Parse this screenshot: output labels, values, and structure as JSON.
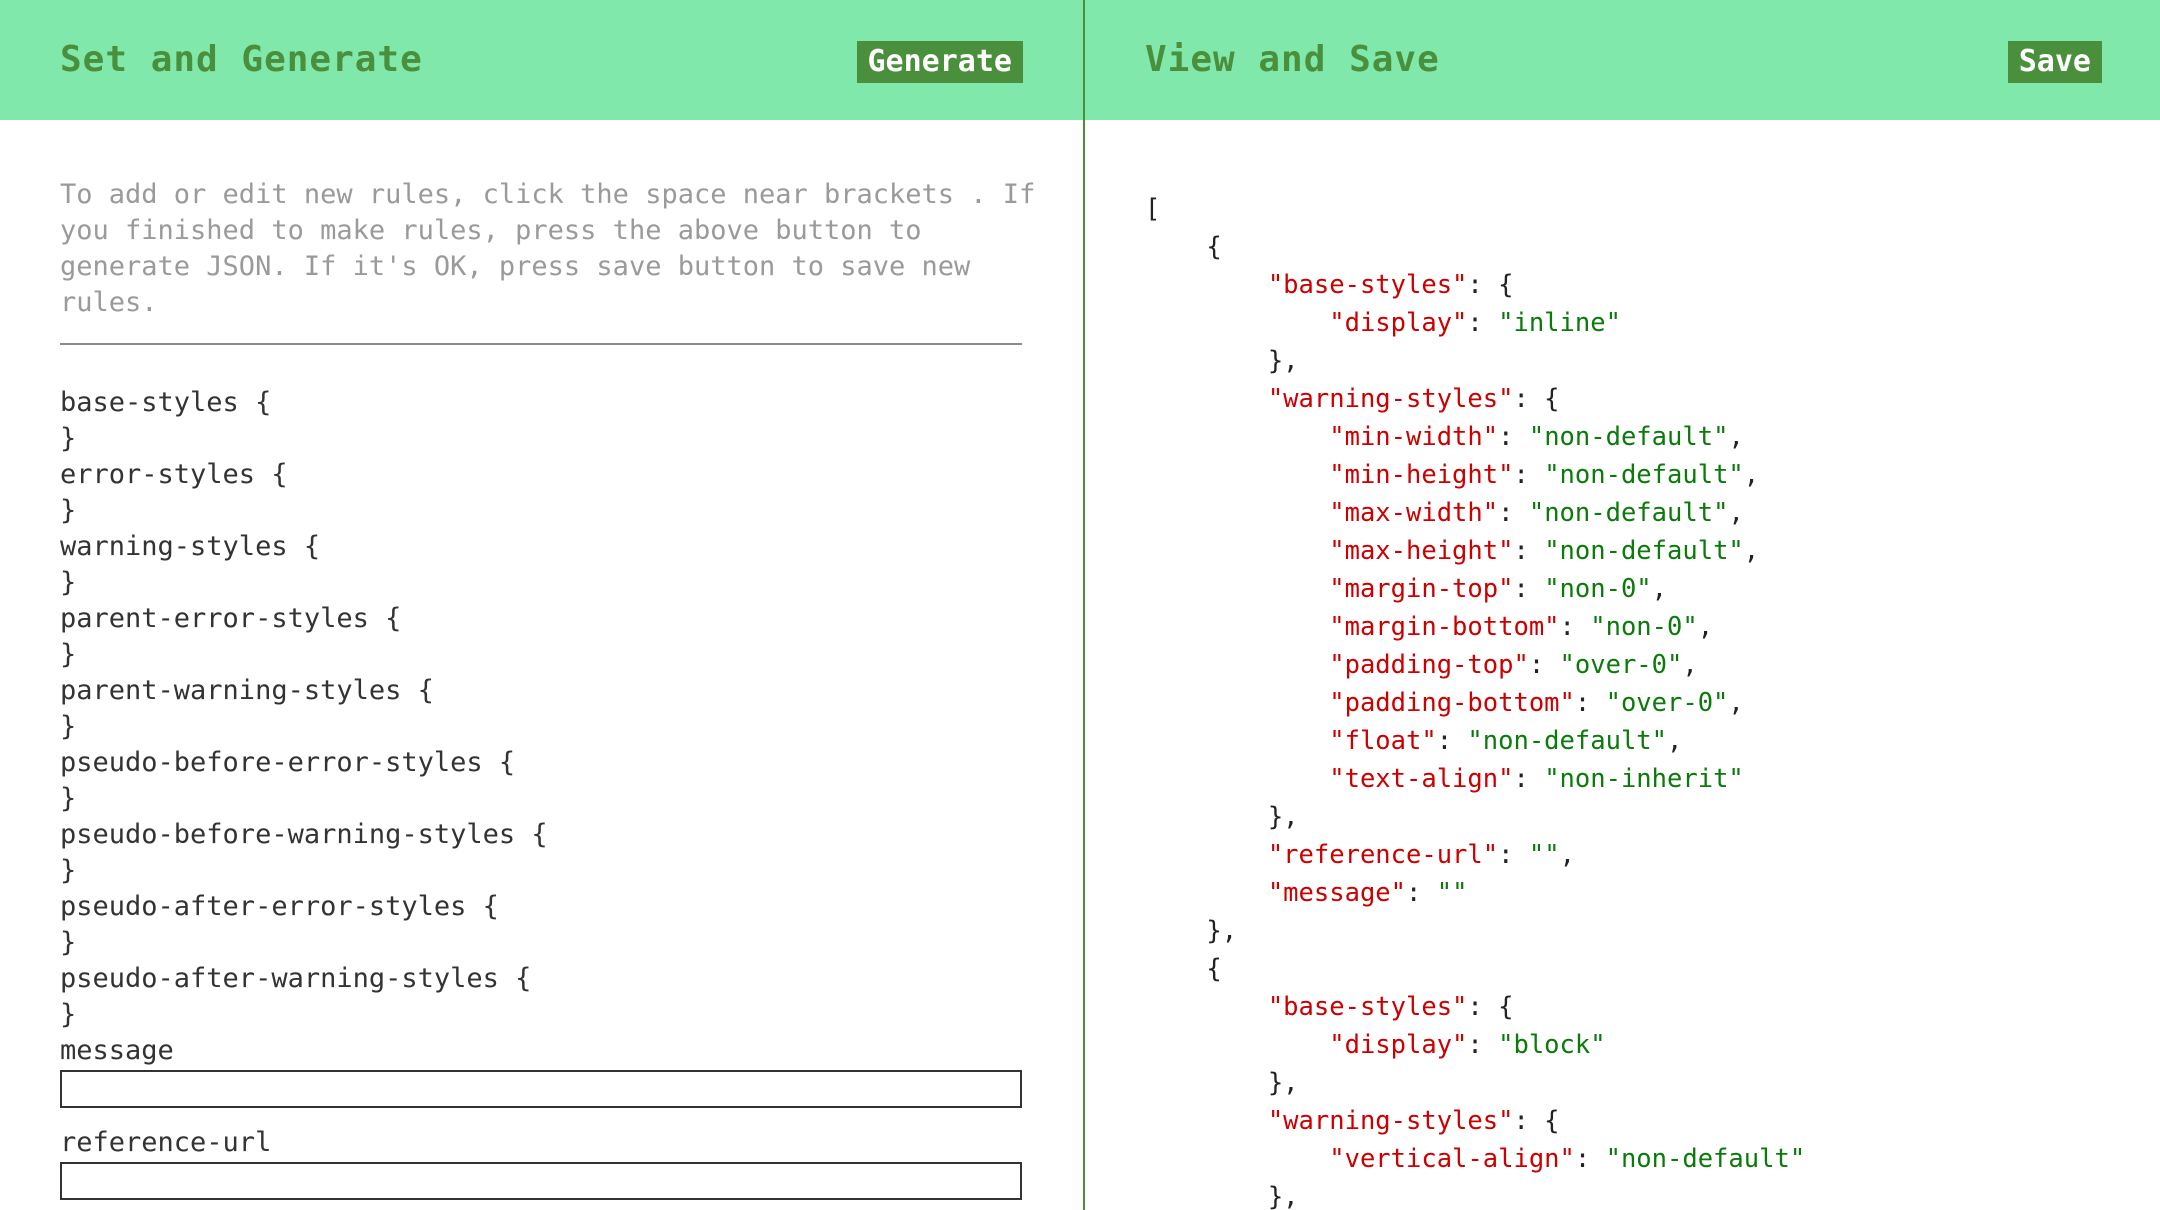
{
  "left": {
    "title": "Set and Generate",
    "generate_label": "Generate",
    "instructions": "To add or edit new rules, click the space near brackets . If you finished to make rules, press the above button to generate JSON. If it's OK, press save button to save new rules.",
    "rules": [
      "base-styles {",
      "}",
      "error-styles {",
      "}",
      "warning-styles {",
      "}",
      "parent-error-styles {",
      "}",
      "parent-warning-styles {",
      "}",
      "pseudo-before-error-styles {",
      "}",
      "pseudo-before-warning-styles {",
      "}",
      "pseudo-after-error-styles {",
      "}",
      "pseudo-after-warning-styles {",
      "}"
    ],
    "message_label": "message",
    "message_value": "",
    "reference_url_label": "reference-url",
    "reference_url_value": ""
  },
  "right": {
    "title": "View and Save",
    "save_label": "Save",
    "json_lines": [
      {
        "indent": 0,
        "parts": [
          [
            "p",
            "["
          ]
        ]
      },
      {
        "indent": 1,
        "parts": [
          [
            "p",
            "{"
          ]
        ]
      },
      {
        "indent": 2,
        "parts": [
          [
            "k",
            "\"base-styles\""
          ],
          [
            "p",
            ": {"
          ]
        ]
      },
      {
        "indent": 3,
        "parts": [
          [
            "k",
            "\"display\""
          ],
          [
            "p",
            ": "
          ],
          [
            "s",
            "\"inline\""
          ]
        ]
      },
      {
        "indent": 2,
        "parts": [
          [
            "p",
            "},"
          ]
        ]
      },
      {
        "indent": 2,
        "parts": [
          [
            "k",
            "\"warning-styles\""
          ],
          [
            "p",
            ": {"
          ]
        ]
      },
      {
        "indent": 3,
        "parts": [
          [
            "k",
            "\"min-width\""
          ],
          [
            "p",
            ": "
          ],
          [
            "s",
            "\"non-default\""
          ],
          [
            "p",
            ","
          ]
        ]
      },
      {
        "indent": 3,
        "parts": [
          [
            "k",
            "\"min-height\""
          ],
          [
            "p",
            ": "
          ],
          [
            "s",
            "\"non-default\""
          ],
          [
            "p",
            ","
          ]
        ]
      },
      {
        "indent": 3,
        "parts": [
          [
            "k",
            "\"max-width\""
          ],
          [
            "p",
            ": "
          ],
          [
            "s",
            "\"non-default\""
          ],
          [
            "p",
            ","
          ]
        ]
      },
      {
        "indent": 3,
        "parts": [
          [
            "k",
            "\"max-height\""
          ],
          [
            "p",
            ": "
          ],
          [
            "s",
            "\"non-default\""
          ],
          [
            "p",
            ","
          ]
        ]
      },
      {
        "indent": 3,
        "parts": [
          [
            "k",
            "\"margin-top\""
          ],
          [
            "p",
            ": "
          ],
          [
            "s",
            "\"non-0\""
          ],
          [
            "p",
            ","
          ]
        ]
      },
      {
        "indent": 3,
        "parts": [
          [
            "k",
            "\"margin-bottom\""
          ],
          [
            "p",
            ": "
          ],
          [
            "s",
            "\"non-0\""
          ],
          [
            "p",
            ","
          ]
        ]
      },
      {
        "indent": 3,
        "parts": [
          [
            "k",
            "\"padding-top\""
          ],
          [
            "p",
            ": "
          ],
          [
            "s",
            "\"over-0\""
          ],
          [
            "p",
            ","
          ]
        ]
      },
      {
        "indent": 3,
        "parts": [
          [
            "k",
            "\"padding-bottom\""
          ],
          [
            "p",
            ": "
          ],
          [
            "s",
            "\"over-0\""
          ],
          [
            "p",
            ","
          ]
        ]
      },
      {
        "indent": 3,
        "parts": [
          [
            "k",
            "\"float\""
          ],
          [
            "p",
            ": "
          ],
          [
            "s",
            "\"non-default\""
          ],
          [
            "p",
            ","
          ]
        ]
      },
      {
        "indent": 3,
        "parts": [
          [
            "k",
            "\"text-align\""
          ],
          [
            "p",
            ": "
          ],
          [
            "s",
            "\"non-inherit\""
          ]
        ]
      },
      {
        "indent": 2,
        "parts": [
          [
            "p",
            "},"
          ]
        ]
      },
      {
        "indent": 2,
        "parts": [
          [
            "k",
            "\"reference-url\""
          ],
          [
            "p",
            ": "
          ],
          [
            "s",
            "\"\""
          ],
          [
            "p",
            ","
          ]
        ]
      },
      {
        "indent": 2,
        "parts": [
          [
            "k",
            "\"message\""
          ],
          [
            "p",
            ": "
          ],
          [
            "s",
            "\"\""
          ]
        ]
      },
      {
        "indent": 1,
        "parts": [
          [
            "p",
            "},"
          ]
        ]
      },
      {
        "indent": 1,
        "parts": [
          [
            "p",
            "{"
          ]
        ]
      },
      {
        "indent": 2,
        "parts": [
          [
            "k",
            "\"base-styles\""
          ],
          [
            "p",
            ": {"
          ]
        ]
      },
      {
        "indent": 3,
        "parts": [
          [
            "k",
            "\"display\""
          ],
          [
            "p",
            ": "
          ],
          [
            "s",
            "\"block\""
          ]
        ]
      },
      {
        "indent": 2,
        "parts": [
          [
            "p",
            "},"
          ]
        ]
      },
      {
        "indent": 2,
        "parts": [
          [
            "k",
            "\"warning-styles\""
          ],
          [
            "p",
            ": {"
          ]
        ]
      },
      {
        "indent": 3,
        "parts": [
          [
            "k",
            "\"vertical-align\""
          ],
          [
            "p",
            ": "
          ],
          [
            "s",
            "\"non-default\""
          ]
        ]
      },
      {
        "indent": 2,
        "parts": [
          [
            "p",
            "},"
          ]
        ]
      }
    ]
  },
  "colors": {
    "header_bg": "#80e8ab",
    "accent": "#4a8f3b",
    "json_key": "#cc0000",
    "json_string": "#0a7a0a"
  }
}
